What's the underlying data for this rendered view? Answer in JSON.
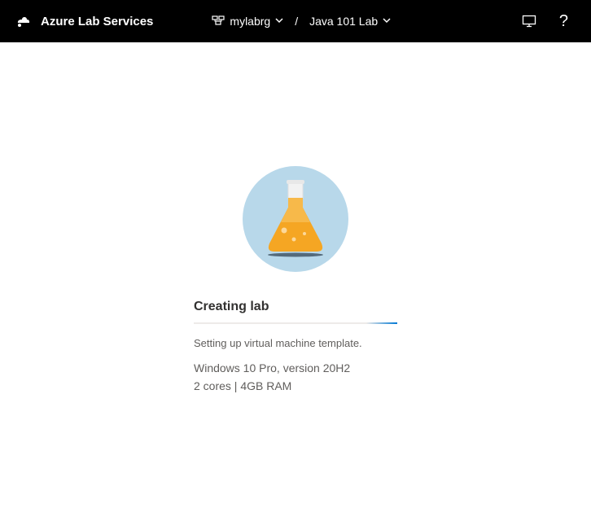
{
  "header": {
    "app_name": "Azure Lab Services",
    "breadcrumb": {
      "resource_group": "mylabrg",
      "lab_name": "Java 101 Lab"
    }
  },
  "status": {
    "title": "Creating lab",
    "message": "Setting up virtual machine template.",
    "vm_os": "Windows 10 Pro, version 20H2",
    "vm_specs": "2 cores | 4GB RAM"
  }
}
